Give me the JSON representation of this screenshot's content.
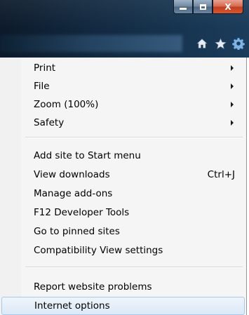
{
  "window": {
    "caption": {
      "minimize_icon": "minimize-icon",
      "maximize_icon": "maximize-icon",
      "close_glyph": "X"
    },
    "toolbar": {
      "home_icon": "home-icon",
      "favorites_icon": "star-icon",
      "tools_icon": "gear-icon"
    }
  },
  "menu": {
    "items": [
      {
        "label": "Print",
        "submenu": true
      },
      {
        "label": "File",
        "submenu": true
      },
      {
        "label": "Zoom (100%)",
        "submenu": true
      },
      {
        "label": "Safety",
        "submenu": true
      },
      {
        "label": "Add site to Start menu"
      },
      {
        "label": "View downloads",
        "shortcut": "Ctrl+J"
      },
      {
        "label": "Manage add-ons"
      },
      {
        "label": "F12 Developer Tools"
      },
      {
        "label": "Go to pinned sites"
      },
      {
        "label": "Compatibility View settings"
      },
      {
        "label": "Report website problems"
      },
      {
        "label": "Internet options",
        "highlighted": true
      }
    ]
  },
  "colors": {
    "menu_background": "#f5f5f5",
    "highlight_border": "#a8c8eb",
    "chrome_dark": "#12283f",
    "close_red": "#c23d1f",
    "icon_light": "#e6edf5",
    "gear_blue": "#7fb3e6"
  }
}
